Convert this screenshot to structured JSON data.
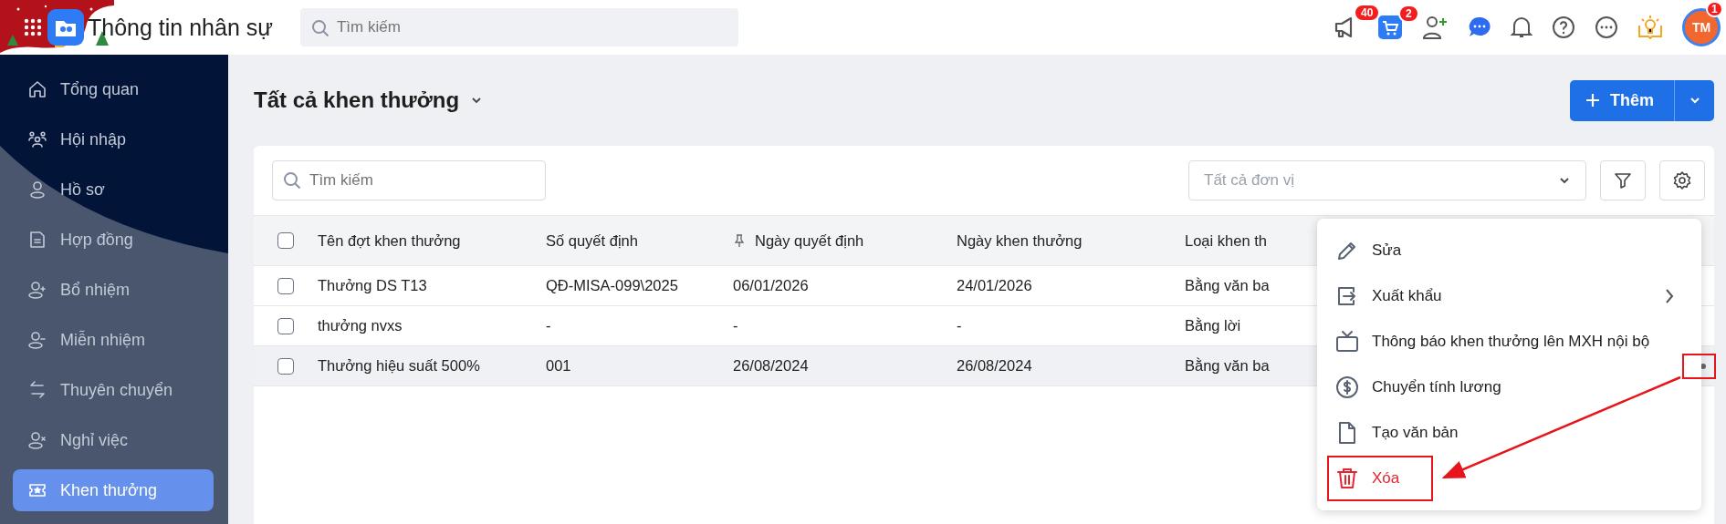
{
  "app": {
    "title": "Thông tin nhân sự",
    "search_placeholder": "Tìm kiếm"
  },
  "header_icons": [
    {
      "kind": "megaphone",
      "badge": "40"
    },
    {
      "kind": "cart",
      "badge": "2"
    },
    {
      "kind": "user-add"
    },
    {
      "kind": "chat"
    },
    {
      "kind": "bell"
    },
    {
      "kind": "help"
    },
    {
      "kind": "more"
    },
    {
      "kind": "idea"
    }
  ],
  "avatar": {
    "initials": "TM",
    "badge": "1"
  },
  "sidebar": {
    "items": [
      {
        "label": "Tổng quan",
        "selected": false
      },
      {
        "label": "Hội nhập",
        "selected": false
      },
      {
        "label": "Hồ sơ",
        "selected": false
      },
      {
        "label": "Hợp đồng",
        "selected": false
      },
      {
        "label": "Bổ nhiệm",
        "selected": false
      },
      {
        "label": "Miễn nhiệm",
        "selected": false
      },
      {
        "label": "Thuyên chuyển",
        "selected": false
      },
      {
        "label": "Nghỉ việc",
        "selected": false
      },
      {
        "label": "Khen thưởng",
        "selected": true
      }
    ]
  },
  "page": {
    "title": "Tất cả khen thưởng",
    "add_button": "Thêm"
  },
  "toolbar": {
    "search_placeholder": "Tìm kiếm",
    "unit_placeholder": "Tất cả đơn vị"
  },
  "table": {
    "all_checked": false,
    "columns": [
      {
        "label": "Tên đợt khen thưởng",
        "pinned": false
      },
      {
        "label": "Số quyết định",
        "pinned": false
      },
      {
        "label": "Ngày quyết định",
        "pinned": true
      },
      {
        "label": "Ngày khen thưởng",
        "pinned": false
      },
      {
        "label": "Loại khen th",
        "pinned": false
      }
    ],
    "rows": [
      {
        "checked": false,
        "selected": false,
        "cells": [
          "Thưởng DS T13",
          "QĐ-MISA-099\\2025",
          "06/01/2026",
          "24/01/2026",
          "Bằng văn ba"
        ]
      },
      {
        "checked": false,
        "selected": false,
        "cells": [
          "thưởng nvxs",
          "-",
          "-",
          "-",
          "Bằng lời"
        ]
      },
      {
        "checked": false,
        "selected": true,
        "cells": [
          "Thưởng hiệu suất 500%",
          "001",
          "26/08/2024",
          "26/08/2024",
          "Bằng văn ba"
        ]
      }
    ]
  },
  "context_menu": {
    "items": [
      {
        "label": "Sửa",
        "danger": false,
        "submenu": false,
        "highlighted": false
      },
      {
        "label": "Xuất khẩu",
        "danger": false,
        "submenu": true,
        "highlighted": false
      },
      {
        "label": "Thông báo khen thưởng lên MXH nội bộ",
        "danger": false,
        "submenu": false,
        "highlighted": false
      },
      {
        "label": "Chuyển tính lương",
        "danger": false,
        "submenu": false,
        "highlighted": false
      },
      {
        "label": "Tạo văn bản",
        "danger": false,
        "submenu": false,
        "highlighted": false
      },
      {
        "label": "Xóa",
        "danger": true,
        "submenu": false,
        "highlighted": true
      }
    ]
  }
}
